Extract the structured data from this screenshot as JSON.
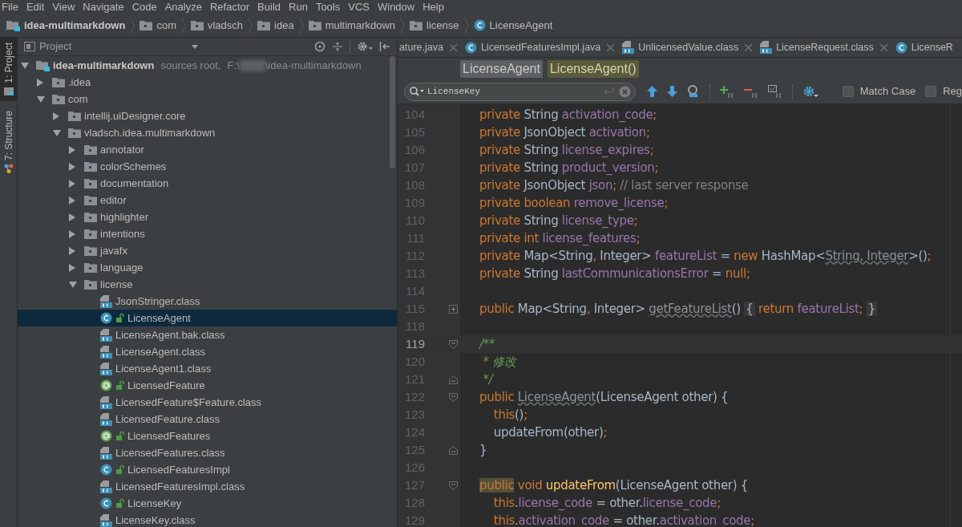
{
  "menu": [
    "File",
    "Edit",
    "View",
    "Navigate",
    "Code",
    "Analyze",
    "Refactor",
    "Build",
    "Run",
    "Tools",
    "VCS",
    "Window",
    "Help"
  ],
  "breadcrumb": [
    {
      "label": "idea-multimarkdown",
      "kind": "module"
    },
    {
      "label": "com",
      "kind": "folder"
    },
    {
      "label": "vladsch",
      "kind": "folder"
    },
    {
      "label": "idea",
      "kind": "folder"
    },
    {
      "label": "multimarkdown",
      "kind": "folder"
    },
    {
      "label": "license",
      "kind": "folder"
    },
    {
      "label": "LicenseAgent",
      "kind": "class"
    }
  ],
  "tool_strip": [
    {
      "label": "1: Project",
      "kind": "project",
      "selected": true
    },
    {
      "label": "7: Structure",
      "kind": "structure",
      "selected": false
    }
  ],
  "project_panel": {
    "title": "Project",
    "root": {
      "label": "idea-multimarkdown",
      "kind": "module",
      "note": "sources root,",
      "path_start": "F:\\",
      "path_end": "\\idea-multimarkdown",
      "expanded": true,
      "selected": false,
      "children": [
        {
          "label": ".idea",
          "kind": "folder",
          "expanded": false,
          "selected": false
        },
        {
          "label": "com",
          "kind": "folder",
          "expanded": true,
          "selected": false,
          "children": [
            {
              "label": "intellij.uiDesigner.core",
              "kind": "folder",
              "expanded": false,
              "selected": false
            },
            {
              "label": "vladsch.idea.multimarkdown",
              "kind": "folder",
              "expanded": true,
              "selected": false,
              "children": [
                {
                  "label": "annotator",
                  "kind": "folder",
                  "expanded": false,
                  "selected": false
                },
                {
                  "label": "colorSchemes",
                  "kind": "folder",
                  "expanded": false,
                  "selected": false
                },
                {
                  "label": "documentation",
                  "kind": "folder",
                  "expanded": false,
                  "selected": false
                },
                {
                  "label": "editor",
                  "kind": "folder",
                  "expanded": false,
                  "selected": false
                },
                {
                  "label": "highlighter",
                  "kind": "folder",
                  "expanded": false,
                  "selected": false
                },
                {
                  "label": "intentions",
                  "kind": "folder",
                  "expanded": false,
                  "selected": false
                },
                {
                  "label": "javafx",
                  "kind": "folder",
                  "expanded": false,
                  "selected": false
                },
                {
                  "label": "language",
                  "kind": "folder",
                  "expanded": false,
                  "selected": false
                },
                {
                  "label": "license",
                  "kind": "folder",
                  "expanded": true,
                  "selected": false,
                  "children": [
                    {
                      "label": "JsonStringer.class",
                      "kind": "classfile",
                      "selected": false
                    },
                    {
                      "label": "LicenseAgent",
                      "kind": "class",
                      "selected": true
                    },
                    {
                      "label": "LicenseAgent.bak.class",
                      "kind": "classfile",
                      "selected": false
                    },
                    {
                      "label": "LicenseAgent.class",
                      "kind": "classfile",
                      "selected": false
                    },
                    {
                      "label": "LicenseAgent1.class",
                      "kind": "classfile",
                      "selected": false
                    },
                    {
                      "label": "LicensedFeature",
                      "kind": "annotation",
                      "selected": false
                    },
                    {
                      "label": "LicensedFeature$Feature.class",
                      "kind": "classfile",
                      "selected": false
                    },
                    {
                      "label": "LicensedFeature.class",
                      "kind": "classfile",
                      "selected": false
                    },
                    {
                      "label": "LicensedFeatures",
                      "kind": "annotation",
                      "selected": false
                    },
                    {
                      "label": "LicensedFeatures.class",
                      "kind": "classfile",
                      "selected": false
                    },
                    {
                      "label": "LicensedFeaturesImpl",
                      "kind": "class",
                      "selected": false
                    },
                    {
                      "label": "LicensedFeaturesImpl.class",
                      "kind": "classfile",
                      "selected": false
                    },
                    {
                      "label": "LicenseKey",
                      "kind": "class",
                      "selected": false
                    },
                    {
                      "label": "LicenseKey.class",
                      "kind": "classfile",
                      "selected": false
                    }
                  ]
                }
              ]
            }
          ]
        }
      ]
    }
  },
  "editor_tabs": [
    {
      "label": "ature.java",
      "kind": "none"
    },
    {
      "label": "LicensedFeaturesImpl.java",
      "kind": "class"
    },
    {
      "label": "UnlicensedValue.class",
      "kind": "classfile"
    },
    {
      "label": "LicenseRequest.class",
      "kind": "classfile"
    },
    {
      "label": "LicenseR",
      "kind": "class"
    }
  ],
  "structure_path": [
    {
      "label": "LicenseAgent",
      "selected": false
    },
    {
      "label": "LicenseAgent()",
      "selected": true
    }
  ],
  "search": {
    "value": "LicenseKey",
    "options": [
      {
        "label": "Match Case",
        "checked": false
      },
      {
        "label": "Reg",
        "checked": false
      }
    ]
  },
  "code": [
    {
      "number": "104",
      "current": false,
      "tokens": [
        {
          "text": "private",
          "kind": "keyword"
        },
        {
          "text": " String ",
          "kind": "plain"
        },
        {
          "text": "activation_code",
          "kind": "field"
        },
        {
          "text": ";",
          "kind": "keyword"
        }
      ]
    },
    {
      "number": "105",
      "current": false,
      "tokens": [
        {
          "text": "private",
          "kind": "keyword"
        },
        {
          "text": " JsonObject ",
          "kind": "plain"
        },
        {
          "text": "activation",
          "kind": "field"
        },
        {
          "text": ";",
          "kind": "keyword"
        }
      ]
    },
    {
      "number": "106",
      "current": false,
      "tokens": [
        {
          "text": "private",
          "kind": "keyword"
        },
        {
          "text": " String ",
          "kind": "plain"
        },
        {
          "text": "license_expires",
          "kind": "field"
        },
        {
          "text": ";",
          "kind": "keyword"
        }
      ]
    },
    {
      "number": "107",
      "current": false,
      "tokens": [
        {
          "text": "private",
          "kind": "keyword"
        },
        {
          "text": " String ",
          "kind": "plain"
        },
        {
          "text": "product_version",
          "kind": "field"
        },
        {
          "text": ";",
          "kind": "keyword"
        }
      ]
    },
    {
      "number": "108",
      "current": false,
      "tokens": [
        {
          "text": "private",
          "kind": "keyword"
        },
        {
          "text": " JsonObject ",
          "kind": "plain"
        },
        {
          "text": "json",
          "kind": "field"
        },
        {
          "text": ";",
          "kind": "keyword"
        },
        {
          "text": " // last server response",
          "kind": "comment"
        }
      ]
    },
    {
      "number": "109",
      "current": false,
      "tokens": [
        {
          "text": "private boolean",
          "kind": "keyword"
        },
        {
          "text": " remove_license",
          "kind": "field"
        },
        {
          "text": ";",
          "kind": "keyword"
        }
      ]
    },
    {
      "number": "110",
      "current": false,
      "tokens": [
        {
          "text": "private",
          "kind": "keyword"
        },
        {
          "text": " String ",
          "kind": "plain"
        },
        {
          "text": "license_type",
          "kind": "field"
        },
        {
          "text": ";",
          "kind": "keyword"
        }
      ]
    },
    {
      "number": "111",
      "current": false,
      "tokens": [
        {
          "text": "private int",
          "kind": "keyword"
        },
        {
          "text": " license_features",
          "kind": "field"
        },
        {
          "text": ";",
          "kind": "keyword"
        }
      ]
    },
    {
      "number": "112",
      "current": false,
      "tokens": [
        {
          "text": "private",
          "kind": "keyword"
        },
        {
          "text": " Map<String",
          "kind": "plain"
        },
        {
          "text": ",",
          "kind": "keyword"
        },
        {
          "text": " Integer> ",
          "kind": "plain"
        },
        {
          "text": "featureList",
          "kind": "field"
        },
        {
          "text": " = ",
          "kind": "plain"
        },
        {
          "text": "new",
          "kind": "keyword"
        },
        {
          "text": " HashMap<",
          "kind": "plain"
        },
        {
          "text": "String, Integer",
          "kind": "unused"
        },
        {
          "text": ">()",
          "kind": "plain"
        },
        {
          "text": ";",
          "kind": "keyword"
        }
      ]
    },
    {
      "number": "113",
      "current": false,
      "tokens": [
        {
          "text": "private",
          "kind": "keyword"
        },
        {
          "text": " String ",
          "kind": "plain"
        },
        {
          "text": "lastCommunicationsError",
          "kind": "field"
        },
        {
          "text": " = ",
          "kind": "plain"
        },
        {
          "text": "null;",
          "kind": "keyword"
        }
      ]
    },
    {
      "number": "114",
      "current": false
    },
    {
      "number": "115",
      "current": false,
      "kind": "folded",
      "tokens": [
        {
          "text": "public",
          "kind": "keyword"
        },
        {
          "text": " Map<String",
          "kind": "plain"
        },
        {
          "text": ",",
          "kind": "keyword"
        },
        {
          "text": " Integer> ",
          "kind": "plain"
        },
        {
          "text": "getFeatureList",
          "kind": "unused"
        },
        {
          "text": "() ",
          "kind": "plain"
        },
        {
          "text": "{",
          "kind": "folded"
        },
        {
          "text": " return",
          "kind": "keyword"
        },
        {
          "text": " featureList",
          "kind": "field"
        },
        {
          "text": "; ",
          "kind": "keyword"
        },
        {
          "text": "}",
          "kind": "folded"
        }
      ]
    },
    {
      "number": "118",
      "current": false
    },
    {
      "number": "119",
      "current": true,
      "kind": "fold_start",
      "tokens": [
        {
          "text": "/**",
          "kind": "doc"
        }
      ]
    },
    {
      "number": "120",
      "current": false,
      "tokens": [
        {
          "text": " * 修改",
          "kind": "doc"
        }
      ]
    },
    {
      "number": "121",
      "current": false,
      "kind": "fold_end",
      "tokens": [
        {
          "text": " */",
          "kind": "doc"
        }
      ]
    },
    {
      "number": "122",
      "current": false,
      "kind": "fold_start",
      "tokens": [
        {
          "text": "public ",
          "kind": "keyword"
        },
        {
          "text": "LicenseAgent",
          "kind": "unused"
        },
        {
          "text": "(LicenseAgent other) {",
          "kind": "plain"
        }
      ]
    },
    {
      "number": "123",
      "current": false,
      "tokens": [
        {
          "text": "    this",
          "kind": "keyword"
        },
        {
          "text": "()",
          "kind": "plain"
        },
        {
          "text": ";",
          "kind": "keyword"
        }
      ]
    },
    {
      "number": "124",
      "current": false,
      "tokens": [
        {
          "text": "    updateFrom(other)",
          "kind": "plain"
        },
        {
          "text": ";",
          "kind": "keyword"
        }
      ]
    },
    {
      "number": "125",
      "current": false,
      "kind": "fold_end",
      "tokens": [
        {
          "text": "}",
          "kind": "plain"
        }
      ]
    },
    {
      "number": "126",
      "current": false
    },
    {
      "number": "127",
      "current": false,
      "kind": "fold_start",
      "tokens": [
        {
          "text": "public",
          "kind": "marked"
        },
        {
          "text": " void ",
          "kind": "keyword"
        },
        {
          "text": "updateFrom",
          "kind": "method"
        },
        {
          "text": "(LicenseAgent other) {",
          "kind": "plain"
        }
      ]
    },
    {
      "number": "128",
      "current": false,
      "tokens": [
        {
          "text": "    this",
          "kind": "keyword"
        },
        {
          "text": ".",
          "kind": "plain"
        },
        {
          "text": "license_code",
          "kind": "field"
        },
        {
          "text": " = other.",
          "kind": "plain"
        },
        {
          "text": "license_code",
          "kind": "field"
        },
        {
          "text": ";",
          "kind": "keyword"
        }
      ]
    },
    {
      "number": "129",
      "current": false,
      "tokens": [
        {
          "text": "    this",
          "kind": "keyword"
        },
        {
          "text": ".",
          "kind": "plain"
        },
        {
          "text": "activation_code",
          "kind": "field"
        },
        {
          "text": " = other.",
          "kind": "plain"
        },
        {
          "text": "activation_code",
          "kind": "field"
        },
        {
          "text": ";",
          "kind": "keyword"
        }
      ]
    }
  ]
}
